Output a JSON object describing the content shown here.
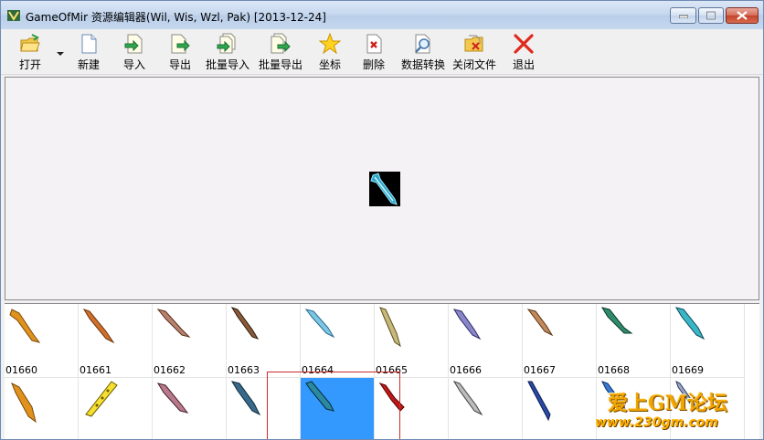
{
  "window": {
    "title": "GameOfMir 资源编辑器(Wil, Wis, Wzl, Pak) [2013-12-24]"
  },
  "toolbar": {
    "items": [
      {
        "label": "打开",
        "icon": "folder-open-icon"
      },
      {
        "label": "新建",
        "icon": "new-file-icon"
      },
      {
        "label": "导入",
        "icon": "import-icon"
      },
      {
        "label": "导出",
        "icon": "export-icon"
      },
      {
        "label": "批量导入",
        "icon": "batch-import-icon"
      },
      {
        "label": "批量导出",
        "icon": "batch-export-icon"
      },
      {
        "label": "坐标",
        "icon": "star-icon"
      },
      {
        "label": "删除",
        "icon": "delete-icon"
      },
      {
        "label": "数据转换",
        "icon": "convert-icon"
      },
      {
        "label": "关闭文件",
        "icon": "close-file-icon"
      },
      {
        "label": "退出",
        "icon": "exit-icon"
      }
    ]
  },
  "grid": {
    "row1": [
      "01660",
      "01661",
      "01662",
      "01663",
      "01664",
      "01665",
      "01666",
      "01667",
      "01668",
      "01669"
    ],
    "selected_index": 14
  },
  "watermark": {
    "line1": "爱上GM论坛",
    "line2": "www.230gm.com"
  },
  "colors": {
    "selection": "#3399ff",
    "focus": "#cc2a2a",
    "close_button": "#c2432c"
  }
}
